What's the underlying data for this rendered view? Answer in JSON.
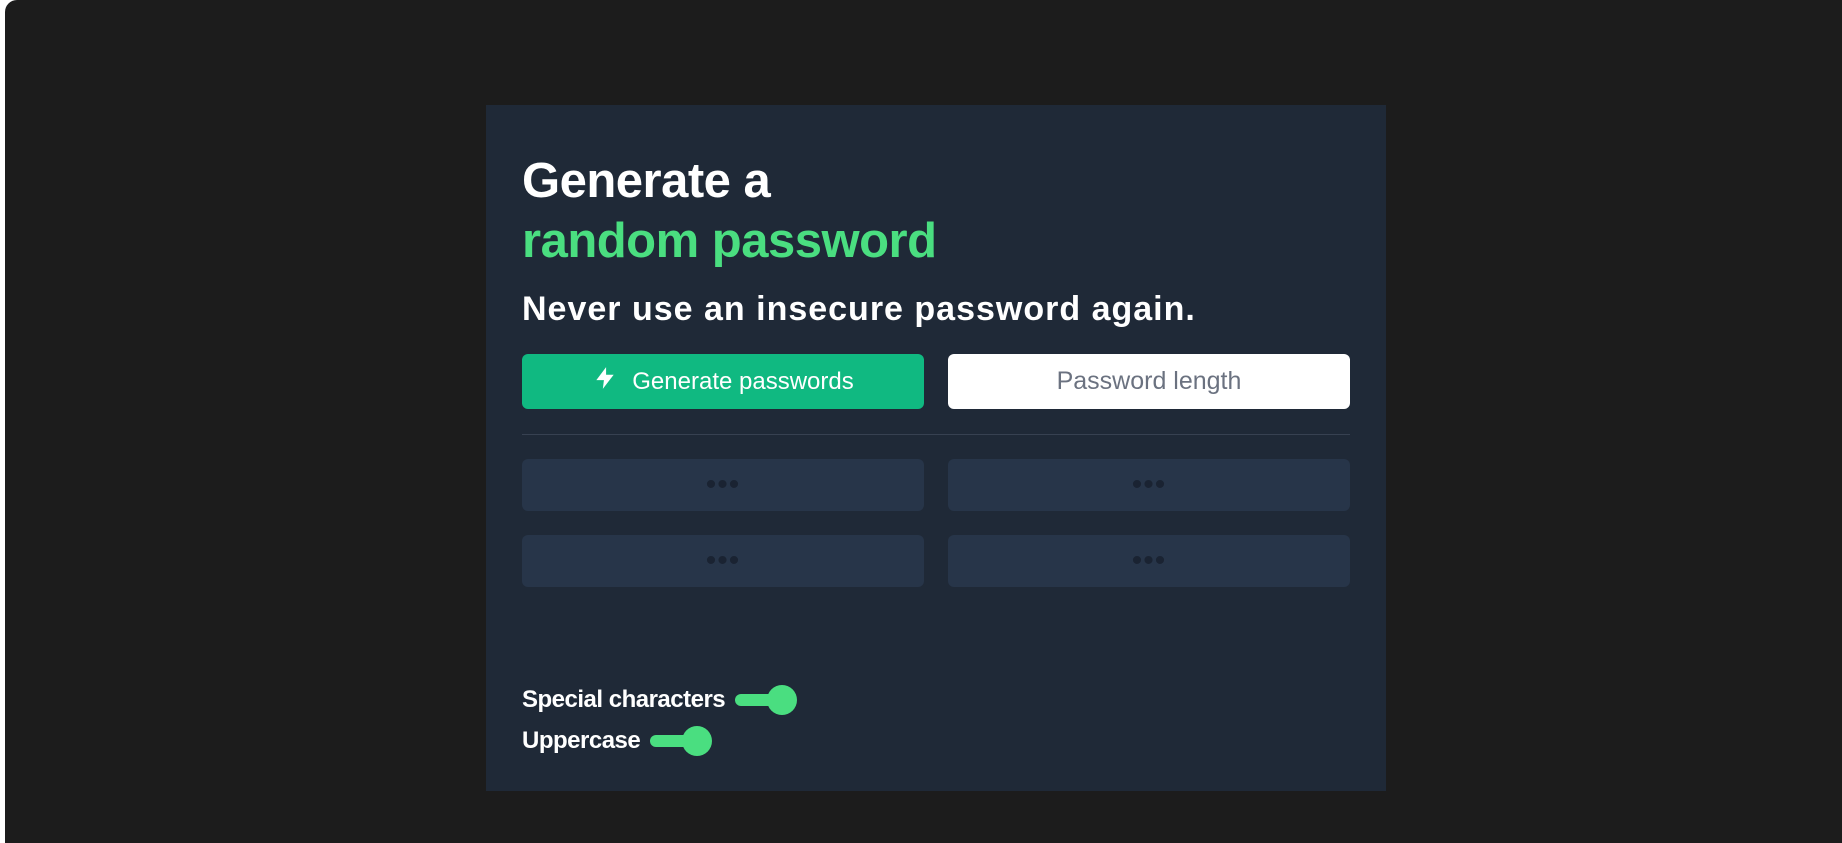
{
  "header": {
    "title_line1": "Generate a",
    "title_line2": "random password",
    "subtitle": "Never use an insecure password again."
  },
  "controls": {
    "generate_label": "Generate passwords",
    "generate_icon": "lightning-bolt-icon",
    "length_placeholder": "Password length",
    "length_value": ""
  },
  "passwords": [
    {
      "value": "•••"
    },
    {
      "value": "•••"
    },
    {
      "value": "•••"
    },
    {
      "value": "•••"
    }
  ],
  "options": {
    "special_characters": {
      "label": "Special characters",
      "enabled": true
    },
    "uppercase": {
      "label": "Uppercase",
      "enabled": true
    }
  },
  "colors": {
    "background": "#1c1c1c",
    "card": "#1f2937",
    "accent_green": "#4ade80",
    "button_green": "#10b981",
    "slot": "#273549"
  }
}
